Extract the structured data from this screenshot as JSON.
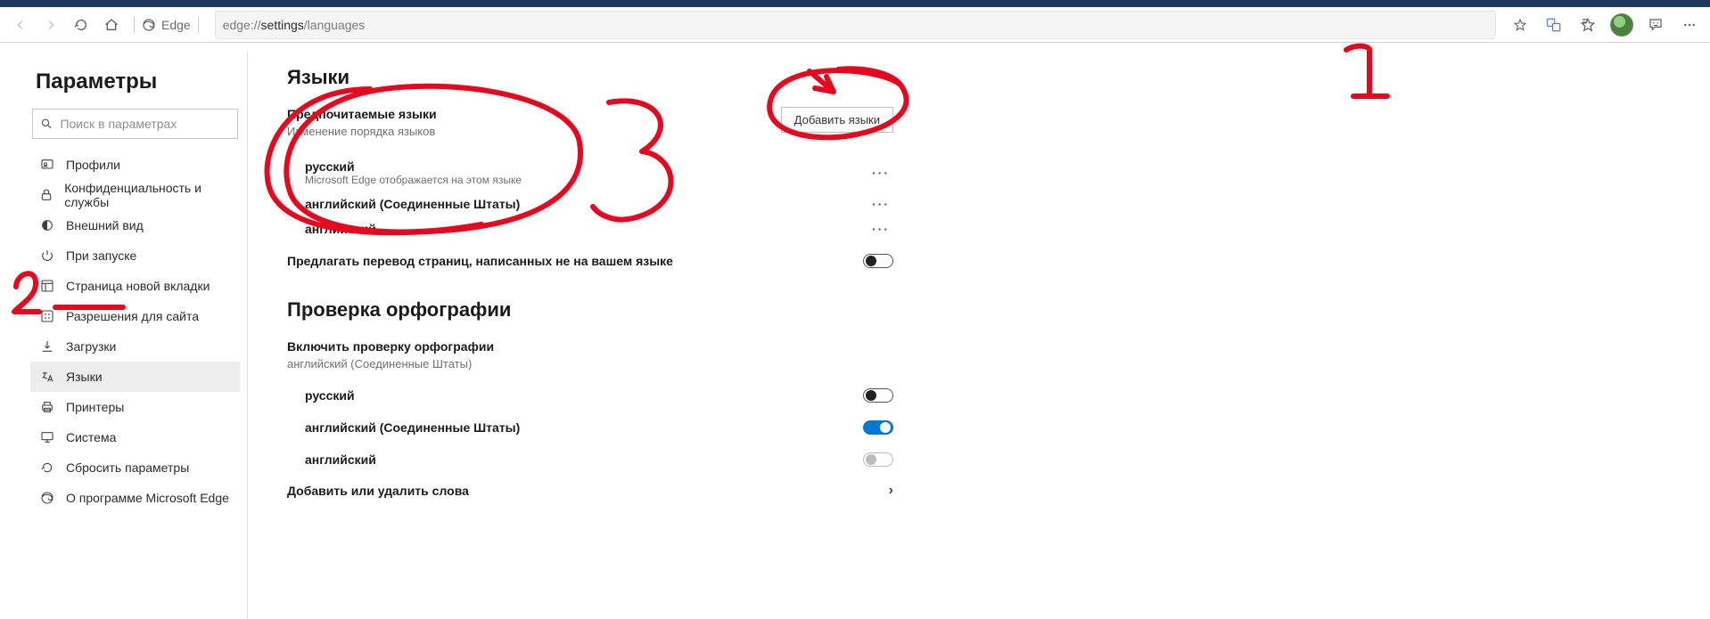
{
  "topbar": {
    "app_label": "Edge",
    "url_prefix": "edge://",
    "url_bold": "settings",
    "url_suffix": "/languages"
  },
  "sidebar": {
    "title": "Параметры",
    "search_placeholder": "Поиск в параметрах",
    "items": [
      {
        "label": "Профили"
      },
      {
        "label": "Конфиденциальность и службы"
      },
      {
        "label": "Внешний вид"
      },
      {
        "label": "При запуске"
      },
      {
        "label": "Страница новой вкладки"
      },
      {
        "label": "Разрешения для сайта"
      },
      {
        "label": "Загрузки"
      },
      {
        "label": "Языки"
      },
      {
        "label": "Принтеры"
      },
      {
        "label": "Система"
      },
      {
        "label": "Сбросить параметры"
      },
      {
        "label": "О программе Microsoft Edge"
      }
    ]
  },
  "languages": {
    "heading": "Языки",
    "preferred_label": "Предпочитаемые языки",
    "preferred_sub": "Изменение порядка языков",
    "add_button": "Добавить языки",
    "items": [
      {
        "name": "русский",
        "sub": "Microsoft Edge отображается на этом языке"
      },
      {
        "name": "английский (Соединенные Штаты)",
        "sub": ""
      },
      {
        "name": "английский",
        "sub": ""
      }
    ],
    "offer_translate": "Предлагать перевод страниц, написанных не на вашем языке"
  },
  "spell": {
    "heading": "Проверка орфографии",
    "enable_label": "Включить проверку орфографии",
    "enable_sub": "английский (Соединенные Штаты)",
    "rows": [
      {
        "name": "русский",
        "state": "off"
      },
      {
        "name": "английский (Соединенные Штаты)",
        "state": "on"
      },
      {
        "name": "английский",
        "state": "disabled"
      }
    ],
    "add_remove": "Добавить или удалить слова"
  },
  "annotations": {
    "1": "1",
    "2": "2",
    "3": "3"
  }
}
